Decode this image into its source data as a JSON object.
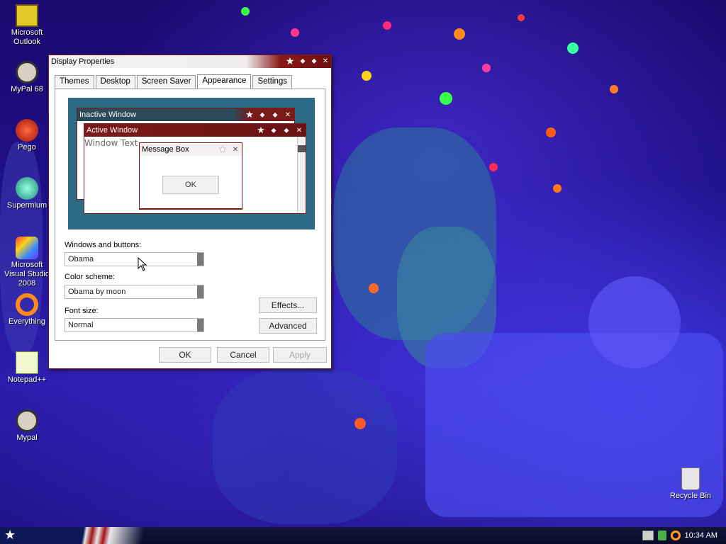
{
  "desktop": {
    "icons": [
      {
        "label": "Microsoft Outlook",
        "icon": "outlook-icon"
      },
      {
        "label": "MyPal 68",
        "icon": "mypal-icon"
      },
      {
        "label": "Pego",
        "icon": "pego-icon"
      },
      {
        "label": "Supermium",
        "icon": "supermium-icon"
      },
      {
        "label": "Microsoft Visual Studio 2008",
        "icon": "visual-studio-icon"
      },
      {
        "label": "Everything",
        "icon": "everything-icon"
      },
      {
        "label": "Notepad++",
        "icon": "notepadpp-icon"
      },
      {
        "label": "Mypal",
        "icon": "mypal-icon"
      },
      {
        "label": "Recycle Bin",
        "icon": "recycle-bin-icon"
      }
    ]
  },
  "window": {
    "title": "Display Properties",
    "tabs": [
      {
        "label": "Themes"
      },
      {
        "label": "Desktop"
      },
      {
        "label": "Screen Saver"
      },
      {
        "label": "Appearance"
      },
      {
        "label": "Settings"
      }
    ],
    "active_tab": "Appearance",
    "preview": {
      "inactive_title": "Inactive Window",
      "active_title": "Active Window",
      "window_text": "Window Text",
      "message_box_title": "Message Box",
      "ok_label": "OK"
    },
    "windows_buttons": {
      "label": "Windows and buttons:",
      "value": "Obama"
    },
    "color_scheme": {
      "label": "Color scheme:",
      "value": "Obama by moon"
    },
    "font_size": {
      "label": "Font size:",
      "value": "Normal"
    },
    "effects_label": "Effects...",
    "advanced_label": "Advanced",
    "ok_label": "OK",
    "cancel_label": "Cancel",
    "apply_label": "Apply"
  },
  "taskbar": {
    "clock": "10:34 AM"
  },
  "colors": {
    "titlebar_accent": "#7a1a1a",
    "preview_bg": "#2d6b85",
    "taskbar_bg": "#0b0b28"
  }
}
